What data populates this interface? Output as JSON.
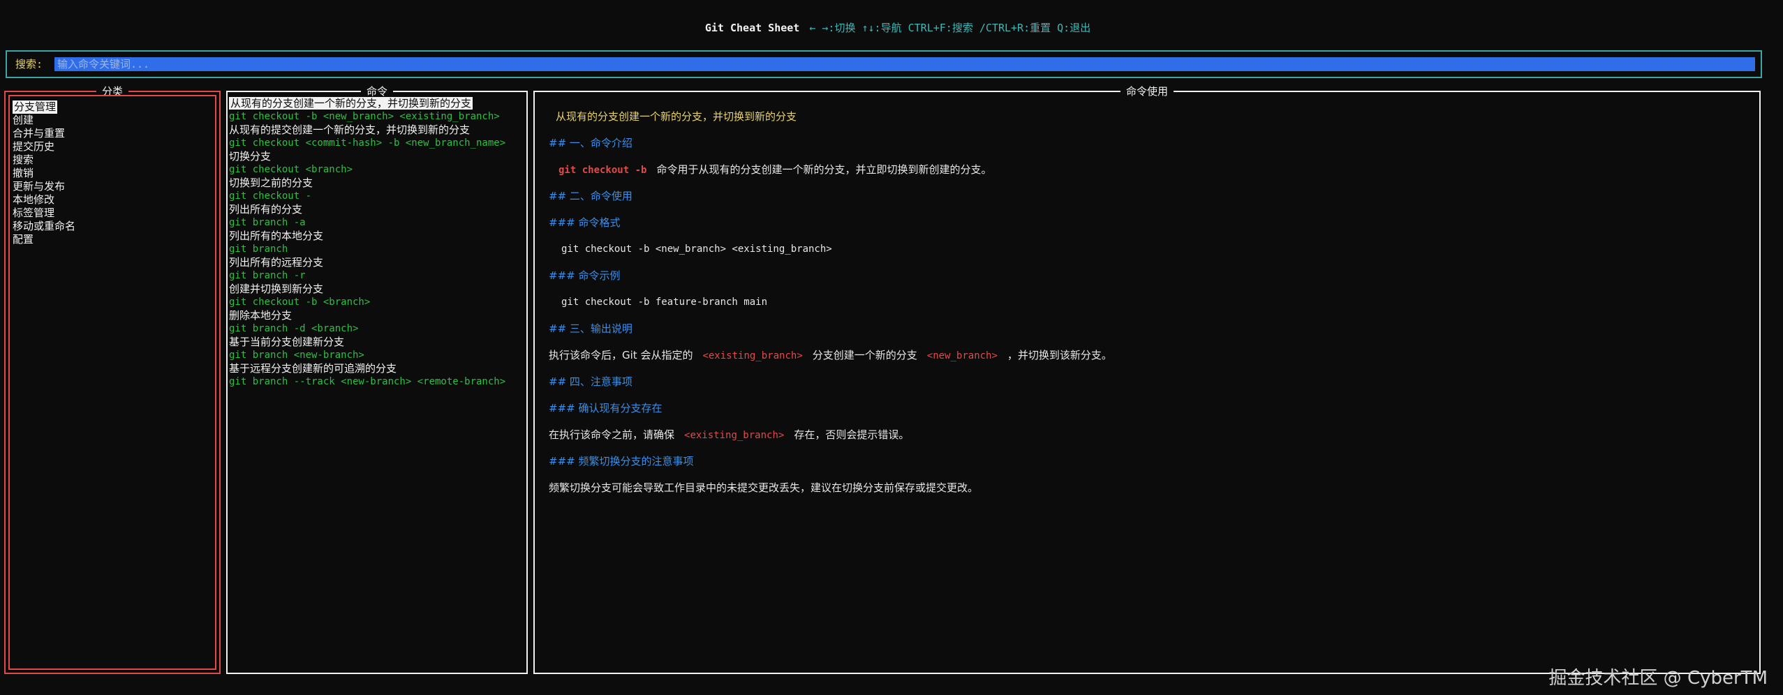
{
  "header": {
    "title": "Git Cheat Sheet",
    "hint": "← →:切换 ↑↓:导航 CTRL+F:搜索 /CTRL+R:重置 Q:退出"
  },
  "search": {
    "label": "搜索:",
    "placeholder": "输入命令关键词..."
  },
  "categories": {
    "title": "分类",
    "items": [
      "分支管理",
      "创建",
      "合并与重置",
      "提交历史",
      "搜索",
      "撤销",
      "更新与发布",
      "本地修改",
      "标签管理",
      "移动或重命名",
      "配置"
    ],
    "selected_index": 0
  },
  "commands": {
    "title": "命令",
    "items": [
      {
        "desc": "从现有的分支创建一个新的分支，并切换到新的分支",
        "code": "git checkout -b <new_branch> <existing_branch>"
      },
      {
        "desc": "从现有的提交创建一个新的分支，并切换到新的分支",
        "code": "git checkout <commit-hash> -b <new_branch_name>"
      },
      {
        "desc": "切换分支",
        "code": "git checkout <branch>"
      },
      {
        "desc": "切换到之前的分支",
        "code": "git checkout -"
      },
      {
        "desc": "列出所有的分支",
        "code": "git branch -a"
      },
      {
        "desc": "列出所有的本地分支",
        "code": "git branch"
      },
      {
        "desc": "列出所有的远程分支",
        "code": "git branch -r"
      },
      {
        "desc": "创建并切换到新分支",
        "code": "git checkout -b <branch>"
      },
      {
        "desc": "删除本地分支",
        "code": "git branch -d <branch>"
      },
      {
        "desc": "基于当前分支创建新分支",
        "code": "git branch <new-branch>"
      },
      {
        "desc": "基于远程分支创建新的可追溯的分支",
        "code": "git branch --track <new-branch> <remote-branch>"
      }
    ],
    "selected_index": 0
  },
  "usage": {
    "title": "命令使用",
    "heading": "从现有的分支创建一个新的分支，并切换到新的分支",
    "s1_title": "## 一、命令介绍",
    "s1_cmd": "git checkout -b",
    "s1_text": "命令用于从现有的分支创建一个新的分支，并立即切换到新创建的分支。",
    "s2_title": "## 二、命令使用",
    "s2_format_title": "### 命令格式",
    "s2_format_code": "git checkout -b <new_branch> <existing_branch>",
    "s2_example_title": "### 命令示例",
    "s2_example_code": "git checkout -b feature-branch main",
    "s3_title": "## 三、输出说明",
    "s3_text1": "执行该命令后，Git 会从指定的",
    "s3_red1": "<existing_branch>",
    "s3_text2": "分支创建一个新的分支",
    "s3_red2": "<new_branch>",
    "s3_text3": "，并切换到该新分支。",
    "s4_title": "## 四、注意事项",
    "s4_sub1_title": "### 确认现有分支存在",
    "s4_sub1_text1": "在执行该命令之前，请确保",
    "s4_sub1_red": "<existing_branch>",
    "s4_sub1_text2": "存在，否则会提示错误。",
    "s4_sub2_title": "### 频繁切换分支的注意事项",
    "s4_sub2_text": "频繁切换分支可能会导致工作目录中的未提交更改丢失，建议在切换分支前保存或提交更改。"
  },
  "watermark": "掘金技术社区 @ CyberTM",
  "colors": {
    "background": "#0c0c0c",
    "accent_teal": "#3aa6a6",
    "search_bg": "#2f6ee8",
    "category_border": "#e24a4a",
    "code_green": "#2fbf47",
    "heading_blue": "#3b8fe8",
    "heading_yellow": "#e8d36a",
    "highlight_red": "#e24a4a"
  }
}
